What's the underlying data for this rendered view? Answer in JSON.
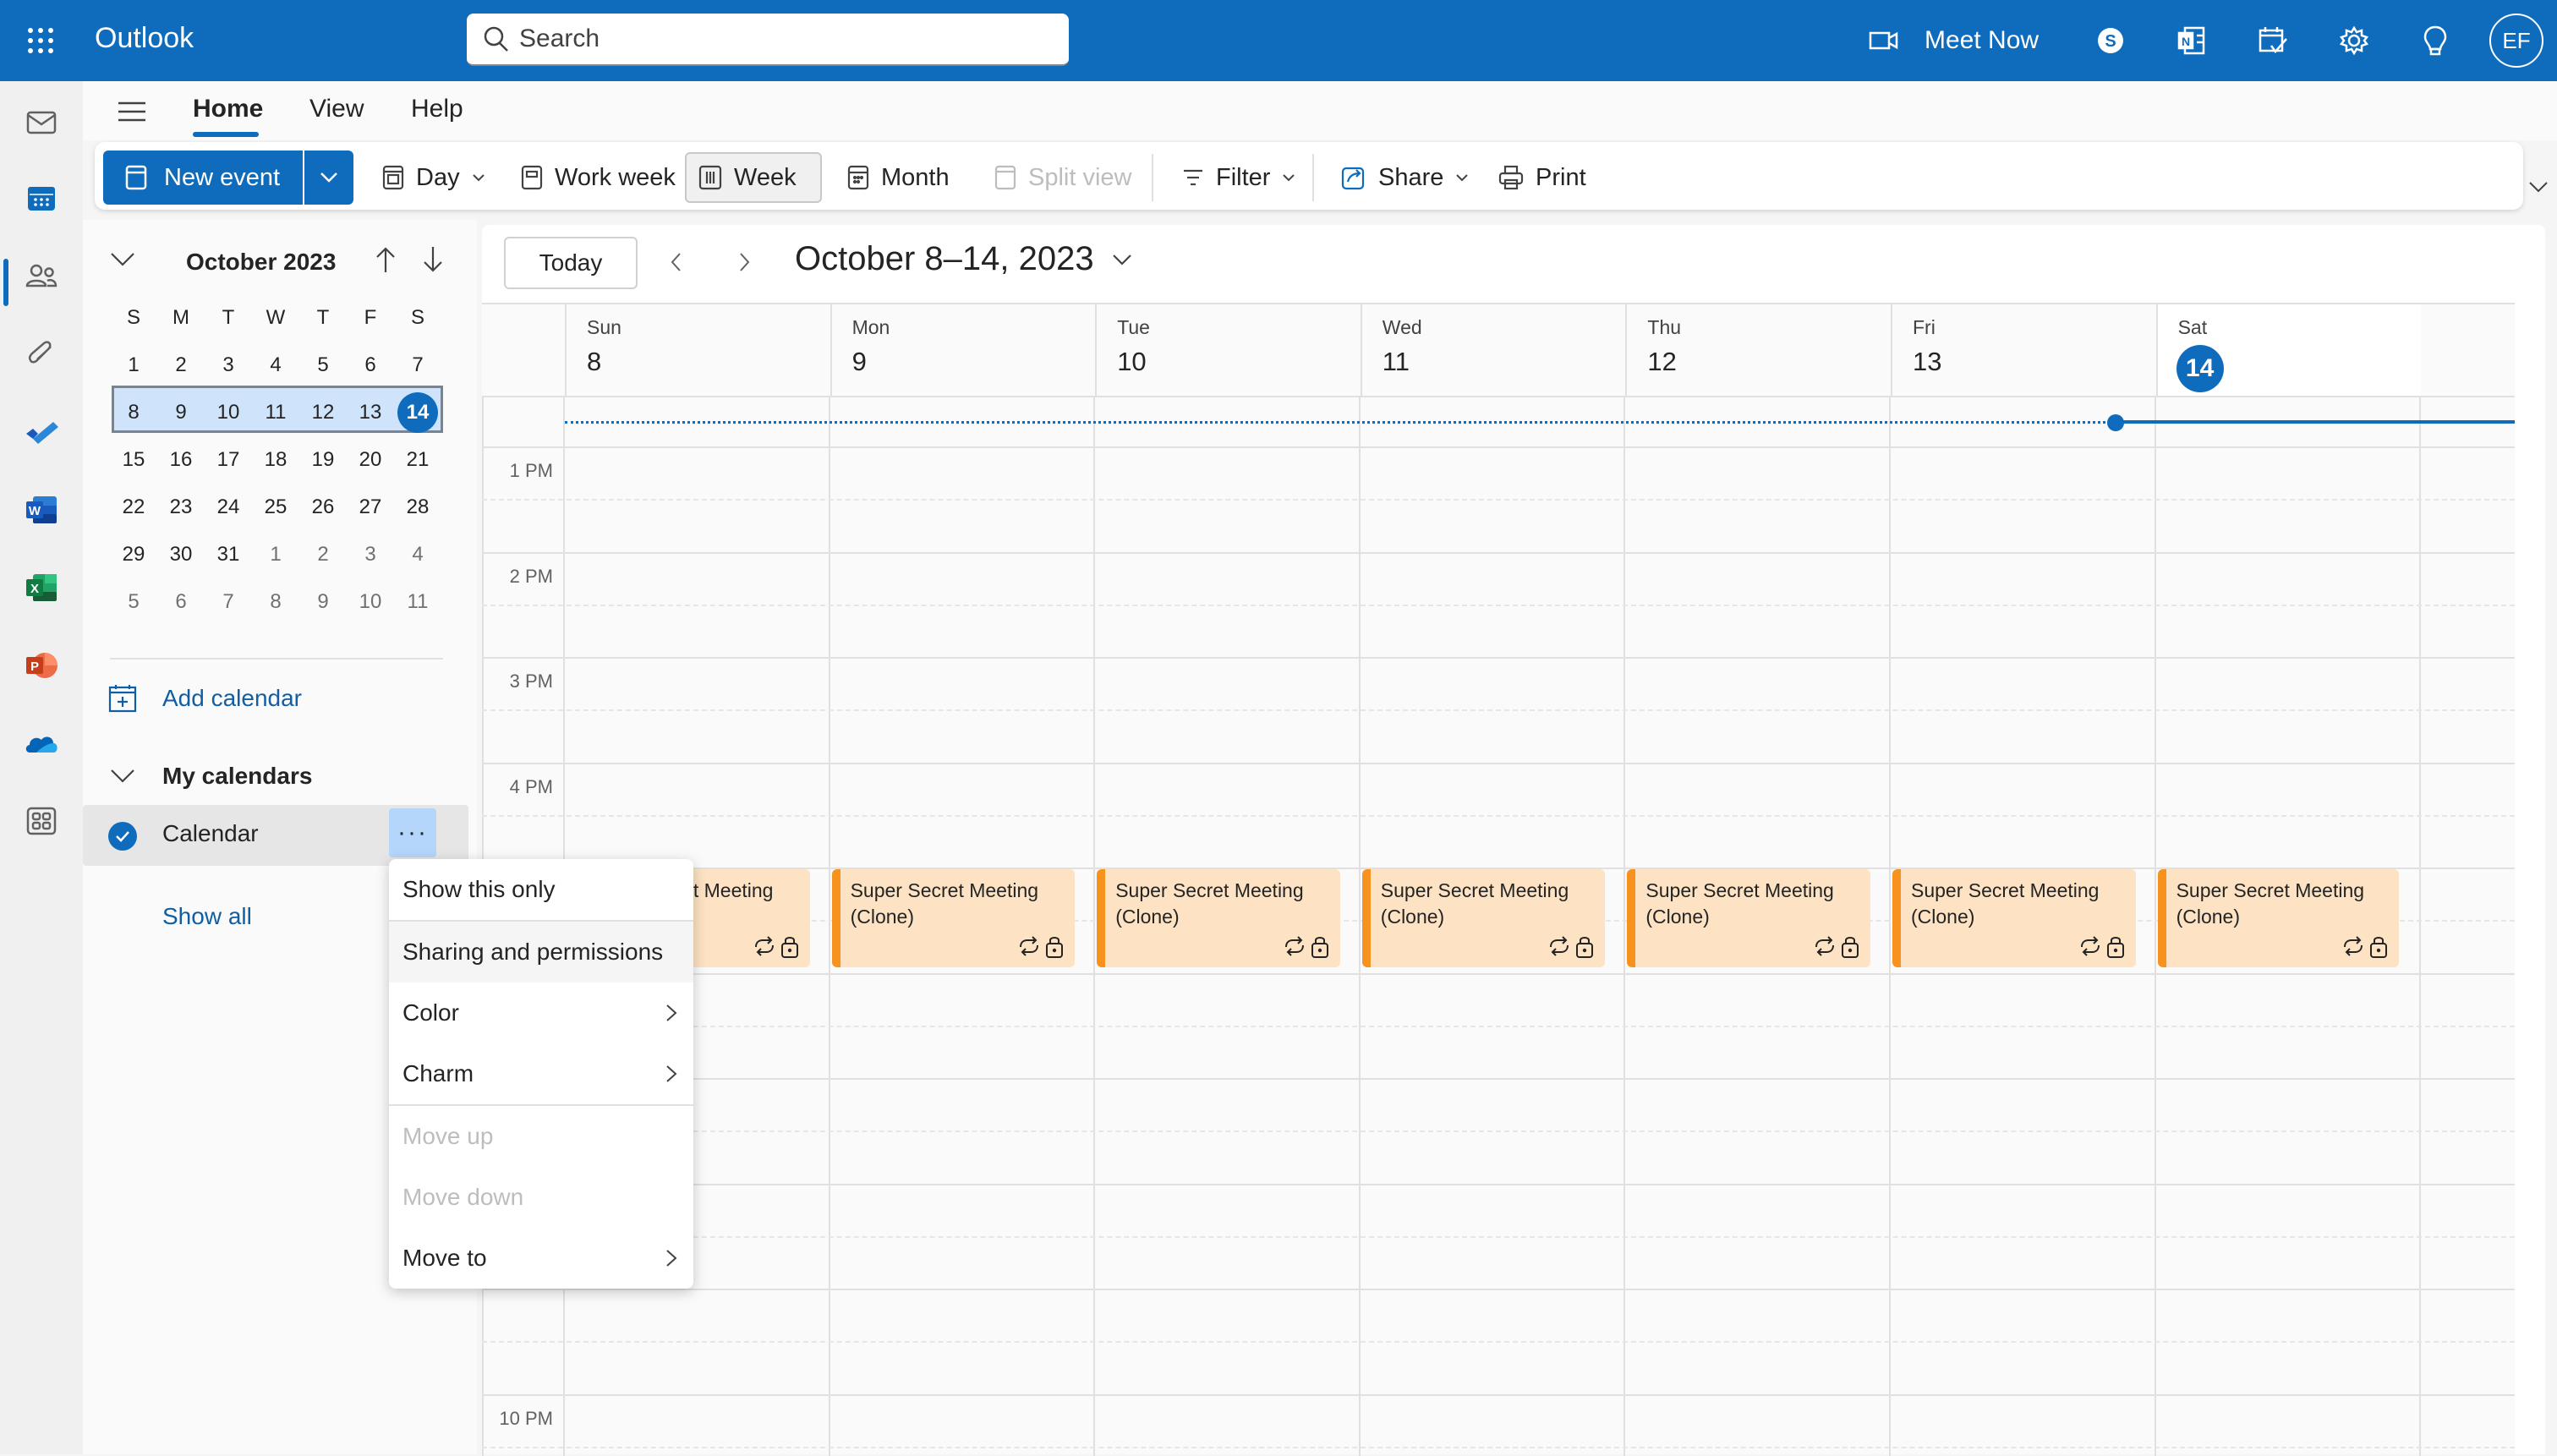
{
  "app": {
    "title": "Outlook",
    "brand_color": "#0f6cbd"
  },
  "topbar": {
    "search_placeholder": "Search",
    "meet_now_label": "Meet Now",
    "icons": [
      "video-camera-icon",
      "skype-icon",
      "onenote-icon",
      "my-day-icon",
      "settings-icon",
      "tips-lightbulb-icon"
    ],
    "avatar_initials": "EF"
  },
  "rail": {
    "items": [
      {
        "name": "mail",
        "active": false
      },
      {
        "name": "calendar",
        "active": true
      },
      {
        "name": "people",
        "active": false
      },
      {
        "name": "files",
        "active": false
      },
      {
        "name": "to-do",
        "active": false
      },
      {
        "name": "word",
        "active": false
      },
      {
        "name": "excel",
        "active": false
      },
      {
        "name": "powerpoint",
        "active": false
      },
      {
        "name": "onedrive",
        "active": false
      },
      {
        "name": "more-apps",
        "active": false
      }
    ]
  },
  "ribbon": {
    "tabs": [
      {
        "label": "Home",
        "active": true
      },
      {
        "label": "View",
        "active": false
      },
      {
        "label": "Help",
        "active": false
      }
    ],
    "new_event_label": "New event",
    "day_label": "Day",
    "work_week_label": "Work week",
    "week_label": "Week",
    "month_label": "Month",
    "split_view_label": "Split view",
    "filter_label": "Filter",
    "share_label": "Share",
    "print_label": "Print",
    "selected_view": "Week"
  },
  "mini_month": {
    "title": "October 2023",
    "weekday_headers": [
      "S",
      "M",
      "T",
      "W",
      "T",
      "F",
      "S"
    ],
    "weeks": [
      [
        "1",
        "2",
        "3",
        "4",
        "5",
        "6",
        "7"
      ],
      [
        "8",
        "9",
        "10",
        "11",
        "12",
        "13",
        "14"
      ],
      [
        "15",
        "16",
        "17",
        "18",
        "19",
        "20",
        "21"
      ],
      [
        "22",
        "23",
        "24",
        "25",
        "26",
        "27",
        "28"
      ],
      [
        "29",
        "30",
        "31",
        "1",
        "2",
        "3",
        "4"
      ],
      [
        "5",
        "6",
        "7",
        "8",
        "9",
        "10",
        "11"
      ]
    ],
    "selected_week_index": 1,
    "today": "14"
  },
  "left_pane": {
    "add_calendar_label": "Add calendar",
    "my_calendars_label": "My calendars",
    "calendar_name": "Calendar",
    "calendar_checked": true,
    "more_label": "···",
    "show_all_label": "Show all"
  },
  "context_menu": {
    "items": [
      {
        "label": "Show this only",
        "disabled": false,
        "submenu": false
      },
      {
        "label": "Sharing and permissions",
        "disabled": false,
        "submenu": false,
        "hover": true
      },
      {
        "label": "Color",
        "disabled": false,
        "submenu": true
      },
      {
        "label": "Charm",
        "disabled": false,
        "submenu": true
      },
      {
        "label": "Move up",
        "disabled": true,
        "submenu": false
      },
      {
        "label": "Move down",
        "disabled": true,
        "submenu": false
      },
      {
        "label": "Move to",
        "disabled": false,
        "submenu": true
      }
    ]
  },
  "calendar": {
    "today_label": "Today",
    "range_title": "October 8–14, 2023",
    "days": [
      {
        "name": "Sun",
        "num": "8",
        "today": false
      },
      {
        "name": "Mon",
        "num": "9",
        "today": false
      },
      {
        "name": "Tue",
        "num": "10",
        "today": false
      },
      {
        "name": "Wed",
        "num": "11",
        "today": false
      },
      {
        "name": "Thu",
        "num": "12",
        "today": false
      },
      {
        "name": "Fri",
        "num": "13",
        "today": false
      },
      {
        "name": "Sat",
        "num": "14",
        "today": true
      }
    ],
    "time_labels": [
      "1 PM",
      "2 PM",
      "3 PM",
      "4 PM",
      "",
      "",
      "",
      "",
      "",
      "10 PM"
    ],
    "events": [
      {
        "day": 0,
        "title": "Super Secret Meeting (Clone)",
        "recurring": true,
        "private": true
      },
      {
        "day": 1,
        "title": "Super Secret Meeting (Clone)",
        "recurring": true,
        "private": true
      },
      {
        "day": 2,
        "title": "Super Secret Meeting (Clone)",
        "recurring": true,
        "private": true
      },
      {
        "day": 3,
        "title": "Super Secret Meeting (Clone)",
        "recurring": true,
        "private": true
      },
      {
        "day": 4,
        "title": "Super Secret Meeting (Clone)",
        "recurring": true,
        "private": true
      },
      {
        "day": 5,
        "title": "Super Secret Meeting (Clone)",
        "recurring": true,
        "private": true
      },
      {
        "day": 6,
        "title": "Super Secret Meeting (Clone)",
        "recurring": true,
        "private": true
      }
    ],
    "event_color": "#fde3c3",
    "event_accent": "#f7921e"
  }
}
